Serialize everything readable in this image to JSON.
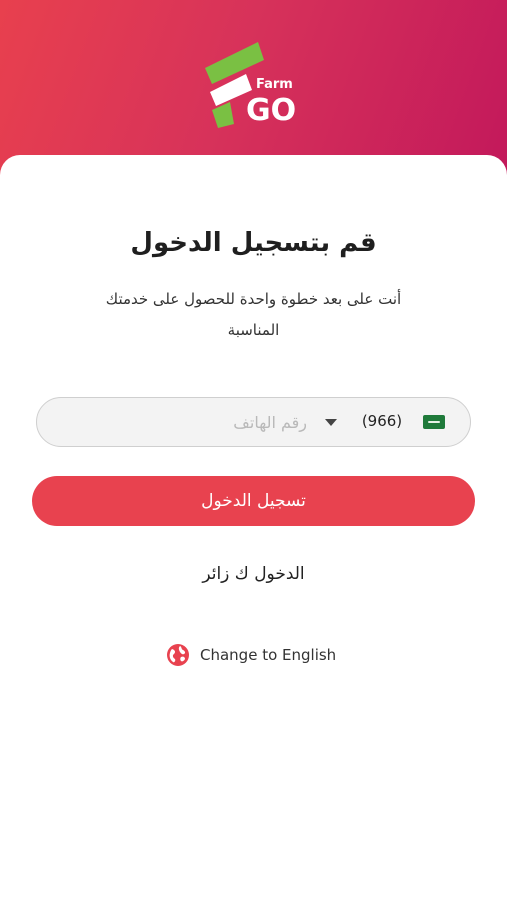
{
  "brand": {
    "logo_word_top": "Farm",
    "logo_word_bottom": "GO",
    "logo_green": "#7ac043"
  },
  "colors": {
    "header_gradient_start": "#e8404e",
    "header_gradient_end": "#c2185b",
    "accent_button": "#e8424f"
  },
  "login": {
    "title": "قم بتسجيل الدخول",
    "subtitle": "أنت على بعد خطوة واحدة للحصول على خدمتك المناسبة",
    "phone": {
      "country_flag_icon": "saudi-flag-icon",
      "country_code": "(966)",
      "placeholder": "رقم الهاتف",
      "value": ""
    },
    "login_button": "تسجيل الدخول",
    "guest_link": "الدخول ك زائر",
    "language": {
      "icon": "globe-icon",
      "label": "Change to English"
    }
  }
}
